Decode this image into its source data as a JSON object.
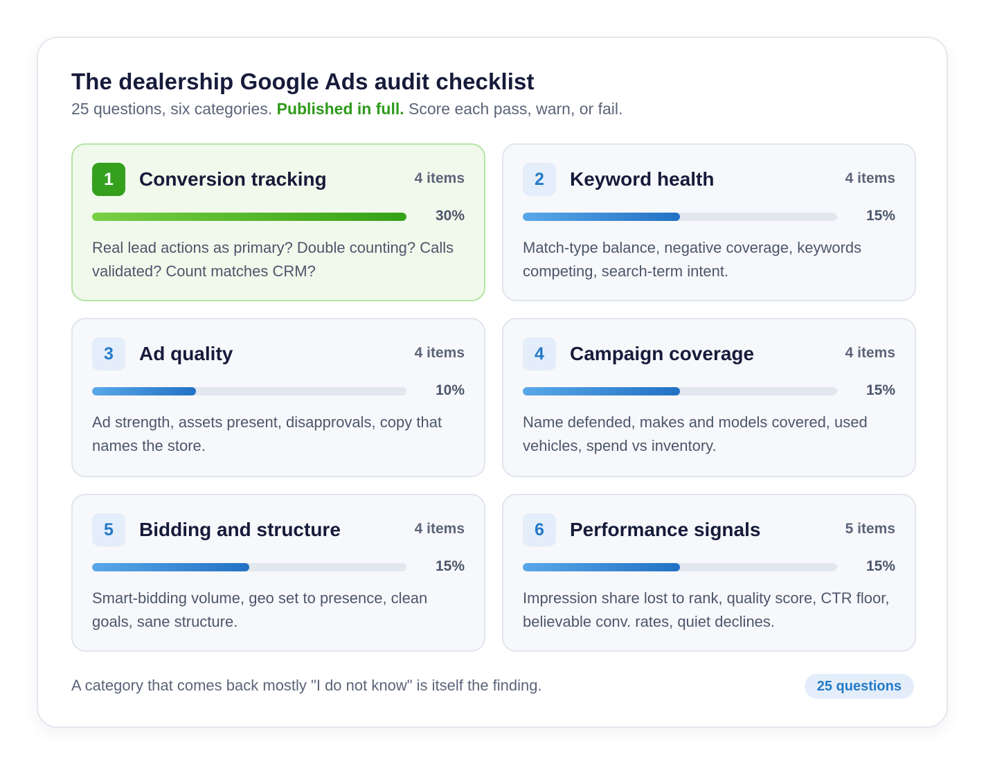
{
  "header": {
    "title": "The dealership Google Ads audit checklist",
    "subtitle_pre": "25 questions, six categories. ",
    "subtitle_highlight": "Published in full.",
    "subtitle_post": " Score each pass, warn, or fail."
  },
  "categories": [
    {
      "number": "1",
      "name": "Conversion tracking",
      "items": "4 items",
      "weight": "30%",
      "weight_value": 30,
      "bar_fraction": 1.0,
      "description": "Real lead actions as primary? Double counting? Calls validated? Count matches CRM?",
      "highlighted": true
    },
    {
      "number": "2",
      "name": "Keyword health",
      "items": "4 items",
      "weight": "15%",
      "weight_value": 15,
      "bar_fraction": 0.5,
      "description": "Match-type balance, negative coverage, keywords competing, search-term intent.",
      "highlighted": false
    },
    {
      "number": "3",
      "name": "Ad quality",
      "items": "4 items",
      "weight": "10%",
      "weight_value": 10,
      "bar_fraction": 0.33,
      "description": "Ad strength, assets present, disapprovals, copy that names the store.",
      "highlighted": false
    },
    {
      "number": "4",
      "name": "Campaign coverage",
      "items": "4 items",
      "weight": "15%",
      "weight_value": 15,
      "bar_fraction": 0.5,
      "description": "Name defended, makes and models covered, used vehicles, spend vs inventory.",
      "highlighted": false
    },
    {
      "number": "5",
      "name": "Bidding and structure",
      "items": "4 items",
      "weight": "15%",
      "weight_value": 15,
      "bar_fraction": 0.5,
      "description": "Smart-bidding volume, geo set to presence, clean goals, sane structure.",
      "highlighted": false
    },
    {
      "number": "6",
      "name": "Performance signals",
      "items": "5 items",
      "weight": "15%",
      "weight_value": 15,
      "bar_fraction": 0.5,
      "description": "Impression share lost to rank, quality score, CTR floor, believable conv. rates, quiet declines.",
      "highlighted": false
    }
  ],
  "footer": {
    "note": "A category that comes back mostly \"I do not know\" is itself the finding.",
    "badge": "25 questions"
  },
  "colors": {
    "highlight_green": "#34a01e",
    "accent_blue": "#2479c7",
    "text_dark": "#161b3a",
    "text_muted": "#5b6478"
  }
}
